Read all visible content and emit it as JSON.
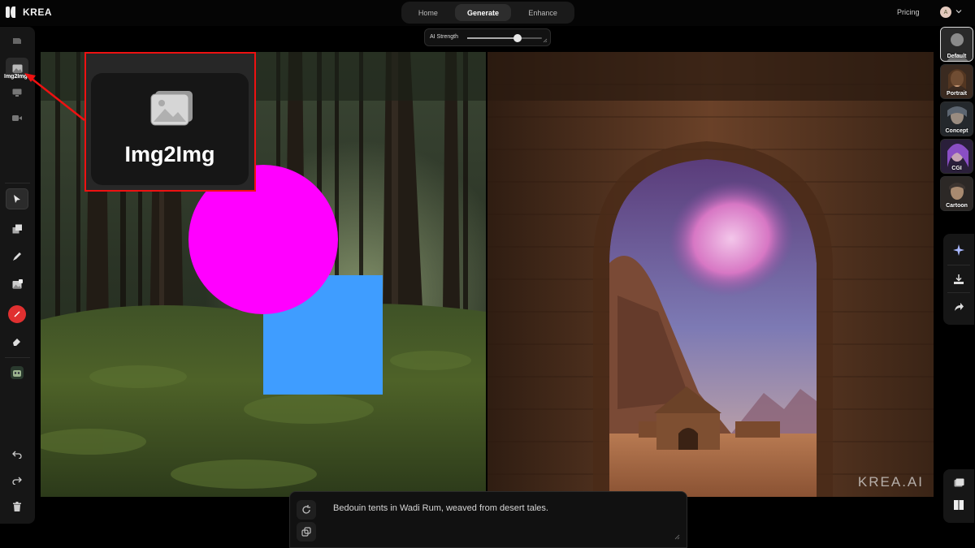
{
  "app": {
    "name": "KREA"
  },
  "nav": {
    "tabs": [
      "Home",
      "Generate",
      "Enhance"
    ],
    "active": "Generate"
  },
  "header": {
    "pricing": "Pricing",
    "avatar_initial": "A"
  },
  "strength": {
    "label": "AI Strength",
    "value": 0.67
  },
  "left_tools": {
    "active_label": "Img2Img",
    "icons": [
      "logo-icon",
      "image-icon",
      "monitor-icon",
      "video-icon",
      "pointer-icon",
      "layers-icon",
      "pen-icon",
      "image-add-icon",
      "record-icon",
      "eraser-icon",
      "robot-icon",
      "undo-icon",
      "redo-icon",
      "trash-icon"
    ]
  },
  "callout": {
    "label": "Img2Img"
  },
  "presets": [
    "Default",
    "Portrait",
    "Concept",
    "CGI",
    "Cartoon"
  ],
  "right_tools": [
    "sparkle-icon",
    "download-icon",
    "share-icon"
  ],
  "view_toggles": [
    "single-view-icon",
    "split-view-icon"
  ],
  "watermark": "KREA.AI",
  "prompt": {
    "text": "Bedouin tents in Wadi Rum, weaved from desert tales."
  },
  "colors": {
    "accent_red": "#e11111",
    "shape_magenta": "#ff00ff",
    "shape_blue": "#3f9dff",
    "bg": "#000000"
  }
}
